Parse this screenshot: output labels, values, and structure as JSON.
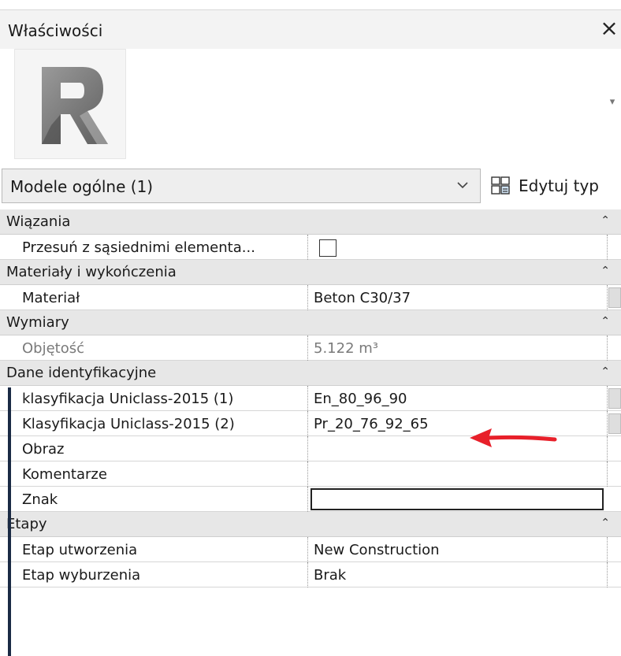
{
  "palette": {
    "title_bg": "#f3f3f3",
    "group_bg": "#e7e7e7",
    "annotation_red": "#e8202a",
    "stripe": "#1a2a44"
  },
  "window": {
    "title": "Właściwości",
    "close_label": "×"
  },
  "preview": {
    "logo_letter": "R",
    "dropdown_icon": "chevron-down-icon"
  },
  "type_selector": {
    "selected": "Modele ogólne (1)",
    "edit_type_label": "Edytuj typ"
  },
  "groups": [
    {
      "label": "Wiązania",
      "rows": [
        {
          "name": "Przesuń z sąsiednimi elementa...",
          "checkbox_checked": false
        }
      ]
    },
    {
      "label": "Materiały i wykończenia",
      "rows": [
        {
          "name": "Materiał",
          "value": "Beton C30/37"
        }
      ]
    },
    {
      "label": "Wymiary",
      "rows": [
        {
          "name": "Objętość",
          "value": "5.122 m³"
        }
      ]
    },
    {
      "label": "Dane identyfikacyjne",
      "rows": [
        {
          "name": "klasyfikacja Uniclass-2015 (1)",
          "value": "En_80_96_90"
        },
        {
          "name": "Klasyfikacja Uniclass-2015 (2)",
          "value": "Pr_20_76_92_65"
        },
        {
          "name": "Obraz",
          "value": ""
        },
        {
          "name": "Komentarze",
          "value": ""
        },
        {
          "name": "Znak",
          "value": ""
        }
      ]
    },
    {
      "label": "Etapy",
      "rows": [
        {
          "name": "Etap utworzenia",
          "value": "New Construction"
        },
        {
          "name": "Etap wyburzenia",
          "value": "Brak"
        }
      ]
    }
  ]
}
